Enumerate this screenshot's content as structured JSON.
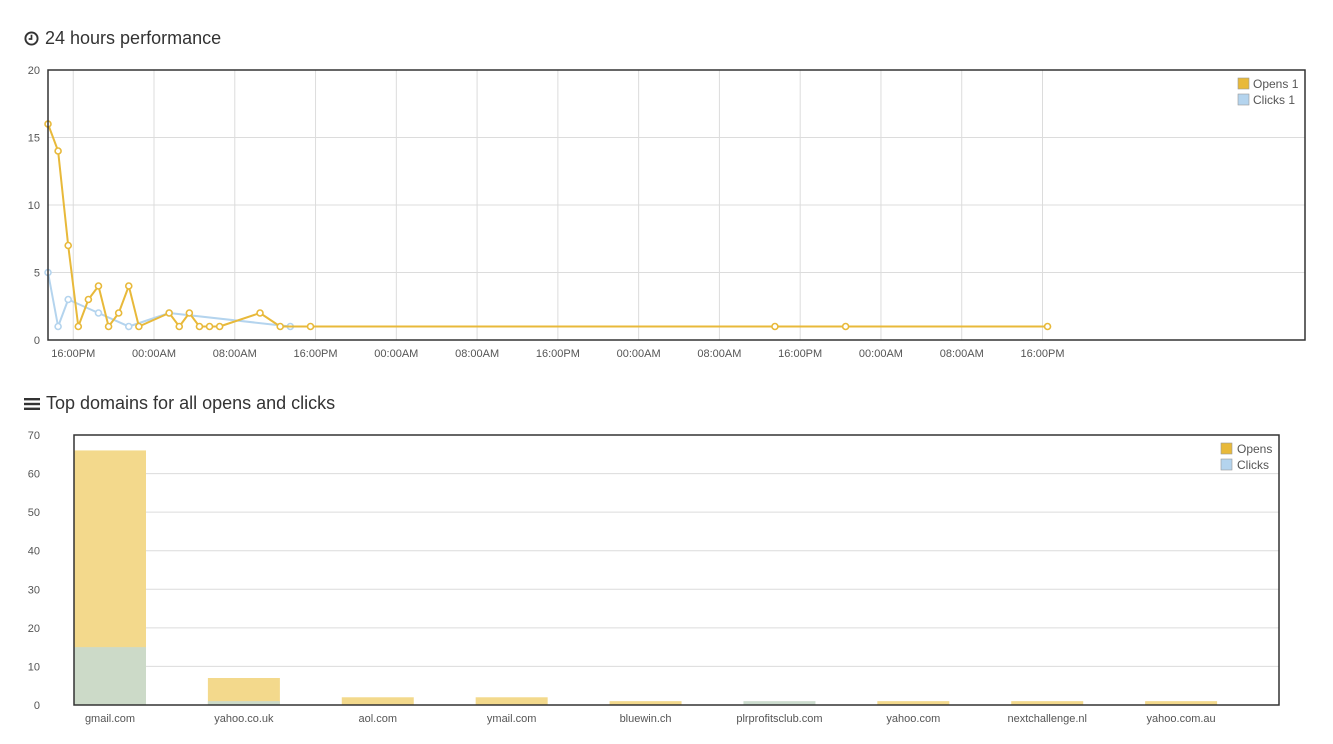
{
  "sections": {
    "performance": {
      "title": "24 hours performance",
      "icon": "clock-icon"
    },
    "domains": {
      "title": "Top domains for all opens and clicks",
      "icon": "list-icon"
    }
  },
  "colors": {
    "opens": "#e8b93a",
    "opens_light": "#f3d98c",
    "clicks": "#b4d4ee",
    "clicks_overlay": "#c9dacb",
    "grid": "#dcdcdc",
    "frame": "#333333"
  },
  "chart_data": [
    {
      "type": "line",
      "title": "24 hours performance",
      "ylim": [
        0,
        20
      ],
      "yticks": [
        0,
        5,
        10,
        15,
        20
      ],
      "x_range_hours": [
        0,
        124.5
      ],
      "xticks": [
        {
          "x": 2.5,
          "label": "16:00PM"
        },
        {
          "x": 10.5,
          "label": "00:00AM"
        },
        {
          "x": 18.5,
          "label": "08:00AM"
        },
        {
          "x": 26.5,
          "label": "16:00PM"
        },
        {
          "x": 34.5,
          "label": "00:00AM"
        },
        {
          "x": 42.5,
          "label": "08:00AM"
        },
        {
          "x": 50.5,
          "label": "16:00PM"
        },
        {
          "x": 58.5,
          "label": "00:00AM"
        },
        {
          "x": 66.5,
          "label": "08:00AM"
        },
        {
          "x": 74.5,
          "label": "16:00PM"
        },
        {
          "x": 82.5,
          "label": "00:00AM"
        },
        {
          "x": 90.5,
          "label": "08:00AM"
        },
        {
          "x": 98.5,
          "label": "16:00PM"
        }
      ],
      "grid": true,
      "legend": "top-right",
      "series": [
        {
          "name": "Opens 1",
          "x": [
            0,
            1,
            2,
            3,
            4,
            5,
            6,
            7,
            8,
            9,
            12,
            13,
            14,
            15,
            16,
            17,
            21,
            23,
            26,
            72,
            79,
            99
          ],
          "y": [
            16,
            14,
            7,
            1,
            3,
            4,
            1,
            2,
            4,
            1,
            2,
            1,
            2,
            1,
            1,
            1,
            2,
            1,
            1,
            1,
            1,
            1
          ]
        },
        {
          "name": "Clicks 1",
          "x": [
            0,
            1,
            2,
            5,
            8,
            12,
            24
          ],
          "y": [
            5,
            1,
            3,
            2,
            1,
            2,
            1
          ]
        }
      ]
    },
    {
      "type": "bar",
      "title": "Top domains for all opens and clicks",
      "categories": [
        "gmail.com",
        "yahoo.co.uk",
        "aol.com",
        "ymail.com",
        "bluewin.ch",
        "plrprofitsclub.com",
        "yahoo.com",
        "nextchallenge.nl",
        "yahoo.com.au"
      ],
      "ylim": [
        0,
        70
      ],
      "yticks": [
        0,
        10,
        20,
        30,
        40,
        50,
        60,
        70
      ],
      "grid": true,
      "legend": "top-right",
      "series": [
        {
          "name": "Opens",
          "values": [
            66,
            7,
            2,
            2,
            1,
            0,
            1,
            1,
            1
          ]
        },
        {
          "name": "Clicks",
          "values": [
            15,
            1,
            0,
            0,
            0,
            1,
            0,
            0,
            0
          ]
        }
      ]
    }
  ]
}
